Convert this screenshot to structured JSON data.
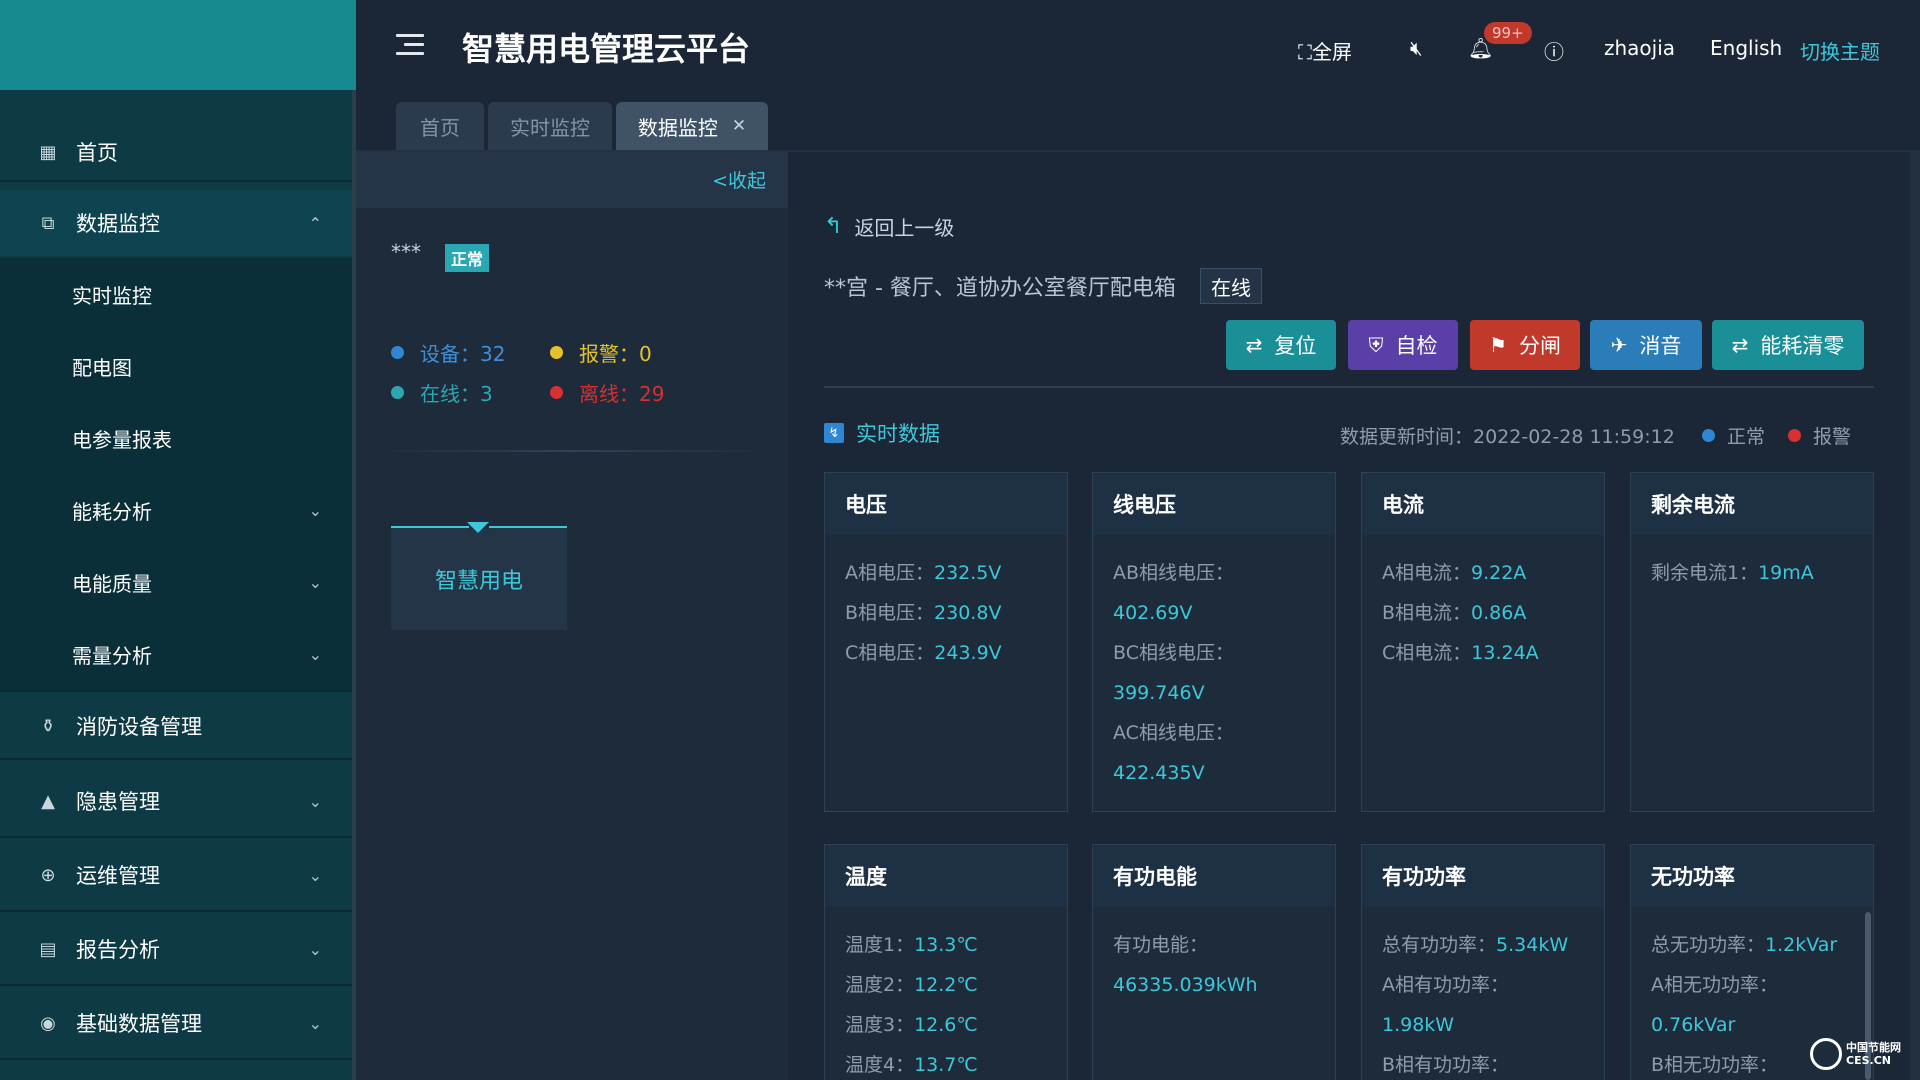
{
  "sidebar": {
    "items": [
      {
        "label": "首页",
        "icon": "building-icon"
      },
      {
        "label": "数据监控",
        "icon": "monitor-icon",
        "expanded": true
      },
      {
        "label": "消防设备管理",
        "icon": "fire-extinguisher-icon"
      },
      {
        "label": "隐患管理",
        "icon": "warning-icon"
      },
      {
        "label": "运维管理",
        "icon": "globe-icon"
      },
      {
        "label": "报告分析",
        "icon": "report-icon"
      },
      {
        "label": "基础数据管理",
        "icon": "database-icon"
      }
    ],
    "submenu": [
      {
        "label": "实时监控"
      },
      {
        "label": "配电图"
      },
      {
        "label": "电参量报表"
      },
      {
        "label": "能耗分析"
      },
      {
        "label": "电能质量"
      },
      {
        "label": "需量分析"
      }
    ]
  },
  "header": {
    "title": "智慧用电管理云平台",
    "fullscreen": "全屏",
    "badge": "99+",
    "user": "zhaojia",
    "language": "English",
    "theme": "切换主题"
  },
  "tabs": [
    {
      "label": "首页"
    },
    {
      "label": "实时监控"
    },
    {
      "label": "数据监控",
      "active": true
    }
  ],
  "left_panel": {
    "collapse": "<收起",
    "device_name": "***",
    "status_badge": "正常",
    "stats": {
      "devices": "设备：32",
      "alarms": "报警：0",
      "online": "在线：3",
      "offline": "离线：29"
    },
    "tree_node": "智慧用电"
  },
  "main": {
    "back": "返回上一级",
    "device_title": "**宫 - 餐厅、道协办公室餐厅配电箱",
    "online_status": "在线",
    "buttons": {
      "reset": "复位",
      "selfcheck": "自检",
      "trip": "分闸",
      "mute": "消音",
      "clear_energy": "能耗清零"
    },
    "realtime_title": "实时数据",
    "update_time": "数据更新时间：2022-02-28 11:59:12",
    "legend_normal": "正常",
    "legend_alarm": "报警",
    "cards": [
      {
        "title": "电压",
        "lines": [
          {
            "label": "A相电压：",
            "value": "232.5V"
          },
          {
            "label": "B相电压：",
            "value": "230.8V"
          },
          {
            "label": "C相电压：",
            "value": "243.9V"
          }
        ]
      },
      {
        "title": "线电压",
        "lines": [
          {
            "label": "AB相线电压：",
            "value": ""
          },
          {
            "label": "",
            "value": "402.69V"
          },
          {
            "label": "BC相线电压：",
            "value": ""
          },
          {
            "label": "",
            "value": "399.746V"
          },
          {
            "label": "AC相线电压：",
            "value": ""
          },
          {
            "label": "",
            "value": "422.435V"
          }
        ]
      },
      {
        "title": "电流",
        "lines": [
          {
            "label": "A相电流：",
            "value": "9.22A"
          },
          {
            "label": "B相电流：",
            "value": "0.86A"
          },
          {
            "label": "C相电流：",
            "value": "13.24A"
          }
        ]
      },
      {
        "title": "剩余电流",
        "lines": [
          {
            "label": "剩余电流1：",
            "value": "19mA"
          }
        ]
      },
      {
        "title": "温度",
        "lines": [
          {
            "label": "温度1：",
            "value": "13.3℃"
          },
          {
            "label": "温度2：",
            "value": "12.2℃"
          },
          {
            "label": "温度3：",
            "value": "12.6℃"
          },
          {
            "label": "温度4：",
            "value": "13.7℃"
          }
        ]
      },
      {
        "title": "有功电能",
        "lines": [
          {
            "label": "有功电能：",
            "value": ""
          },
          {
            "label": "",
            "value": "46335.039kWh"
          }
        ]
      },
      {
        "title": "有功功率",
        "lines": [
          {
            "label": "总有功功率：",
            "value": "5.34kW"
          },
          {
            "label": "A相有功功率：",
            "value": ""
          },
          {
            "label": "",
            "value": "1.98kW"
          },
          {
            "label": "B相有功功率：",
            "value": ""
          }
        ]
      },
      {
        "title": "无功功率",
        "lines": [
          {
            "label": "总无功功率：",
            "value": "1.2kVar"
          },
          {
            "label": "A相无功功率：",
            "value": ""
          },
          {
            "label": "",
            "value": "0.76kVar"
          },
          {
            "label": "B相无功功率：",
            "value": ""
          }
        ]
      }
    ]
  },
  "watermark": {
    "line1": "中国节能网",
    "line2": "CES.CN"
  },
  "colors": {
    "accent": "#3ec7d8",
    "sidebar": "#0d3a45",
    "brand": "#168a8f",
    "btn_reset": "#1a8f98",
    "btn_selfcheck": "#5b3fa8",
    "btn_trip": "#c0392b",
    "btn_mute": "#2a7db8",
    "btn_clear": "#1a8f98",
    "dot_blue": "#2f87d3",
    "dot_yellow": "#e6c22b",
    "dot_teal": "#2ba6b3",
    "dot_red": "#d63030"
  }
}
